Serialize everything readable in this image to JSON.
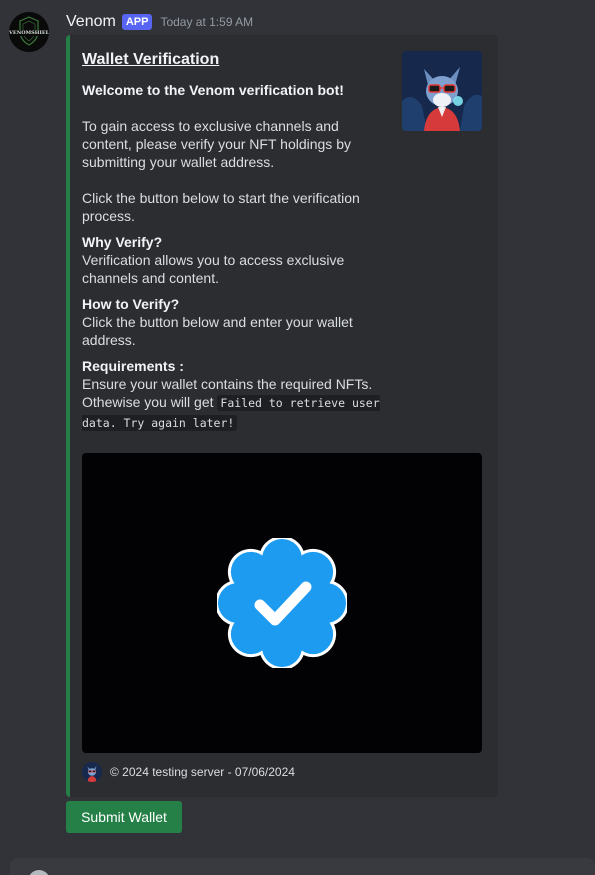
{
  "message": {
    "username": "Venom",
    "badge": "APP",
    "timestamp": "Today at 1:59 AM",
    "avatar_icon": "venomshield-logo-icon",
    "avatar_text": "VENOMSHIELD"
  },
  "embed": {
    "accent_color": "#248046",
    "title": "Wallet Verification",
    "welcome": "Welcome to the Venom verification bot!",
    "intro": "To gain access to exclusive channels and content, please verify your NFT holdings by submitting your wallet address.",
    "click_prompt": "Click the button below to start the verification process.",
    "why_heading": "Why Verify?",
    "why_text": "Verification allows you to access exclusive channels and content.",
    "how_heading": "How to Verify?",
    "how_text": "Click the button below and enter your wallet address.",
    "req_heading": "Requirements :",
    "req_text1": "Ensure your wallet contains the required NFTs.",
    "req_text2": "Othewise you will get ",
    "req_code": "Failed to retrieve user data. Try again later!",
    "thumbnail_icon": "fox-character-icon",
    "image_icon": "verified-badge-icon",
    "footer_icon": "fox-character-icon",
    "footer_text": "© 2024 testing server - 07/06/2024"
  },
  "button": {
    "label": "Submit Wallet",
    "color": "#248046"
  }
}
